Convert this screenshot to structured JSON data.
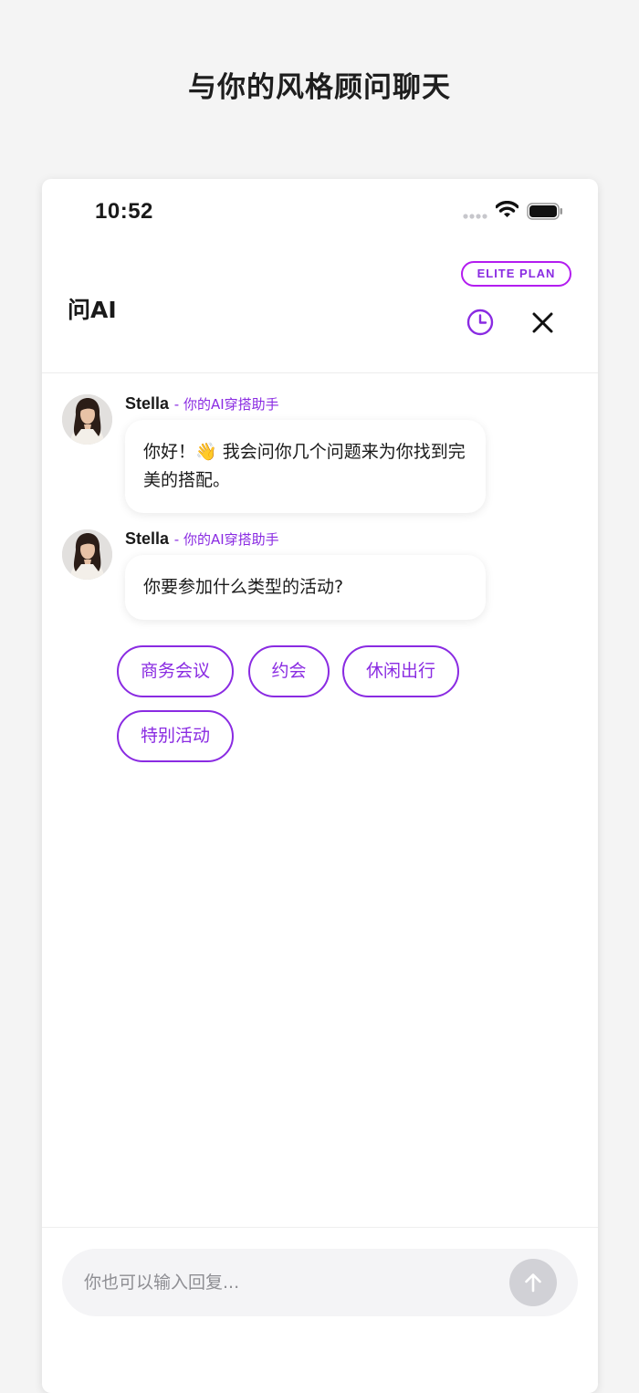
{
  "page": {
    "heading": "与你的风格顾问聊天"
  },
  "status_bar": {
    "time": "10:52"
  },
  "header": {
    "badge": "ELITE PLAN",
    "title": "问AI",
    "history_icon": "clock-icon",
    "close_icon": "close-icon"
  },
  "messages": [
    {
      "sender": "Stella",
      "role": "- 你的AI穿搭助手",
      "text_before_emoji": "你好！",
      "emoji": "👋",
      "text_after_emoji": " 我会问你几个问题来为你找到完美的搭配。"
    },
    {
      "sender": "Stella",
      "role": "- 你的AI穿搭助手",
      "text": "你要参加什么类型的活动?"
    }
  ],
  "options": [
    "商务会议",
    "约会",
    "休闲出行",
    "特别活动"
  ],
  "composer": {
    "placeholder": "你也可以输入回复...",
    "send_icon": "arrow-up-icon"
  },
  "colors": {
    "accent": "#8a2be2",
    "badge_border": "#b31cf0",
    "send_disabled": "#d1d1d6"
  }
}
